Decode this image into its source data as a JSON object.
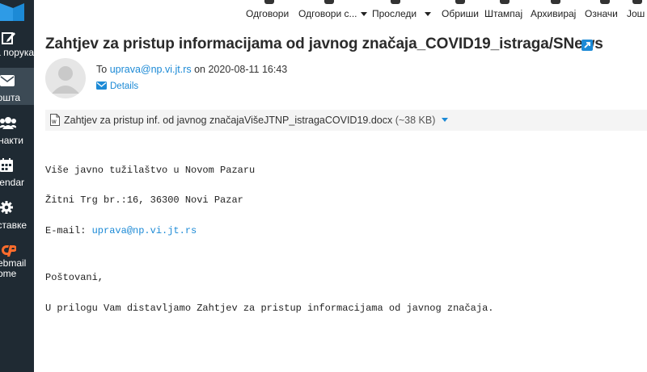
{
  "sidebar": {
    "items": [
      {
        "label": "а порука",
        "icon": "compose-icon"
      },
      {
        "label": "ошта",
        "icon": "envelope-icon"
      },
      {
        "label": "нaкти",
        "icon": "contacts-icon"
      },
      {
        "label": "lendar",
        "icon": "calendar-icon"
      },
      {
        "label": "ставке",
        "icon": "gear-icon"
      },
      {
        "label": "ebmail\nome",
        "icon": "cpanel-icon"
      }
    ]
  },
  "toolbar": {
    "reply": "Одговори",
    "reply_all": "Одговори с...",
    "forward": "Проследи",
    "delete": "Обриши",
    "print": "Штампај",
    "archive": "Архивирај",
    "mark": "Означи",
    "more": "Још"
  },
  "message": {
    "subject": "Zahtjev za pristup informacijama od javnog značaja_COVID19_istraga/SNews",
    "to_prefix": "To",
    "to_address": "uprava@np.vi.jt.rs",
    "date_prefix": " on ",
    "date": "2020-08-11 16:43",
    "details_label": "Details"
  },
  "attachment": {
    "filename": "Zahtjev za pristup inf. od javnog značajaVišeJTNP_istragaCOVID19.docx",
    "size": "(~38 KB)"
  },
  "body": {
    "line1": "Više javno tužilaštvo u Novom Pazaru",
    "line2": "Žitni Trg br.:16, 36300 Novi Pazar",
    "email_label": "E-mail: ",
    "email": "uprava@np.vi.jt.rs",
    "greeting": "Poštovani,",
    "line3": "U prilogu Vam distavljamo Zahtjev za pristup informacijama od javnog značaja."
  },
  "colors": {
    "sidebar": "#1f2a33",
    "sidebar_active": "#3c4a55",
    "link": "#1c8ad6",
    "cpanel": "#ff6c2c"
  }
}
